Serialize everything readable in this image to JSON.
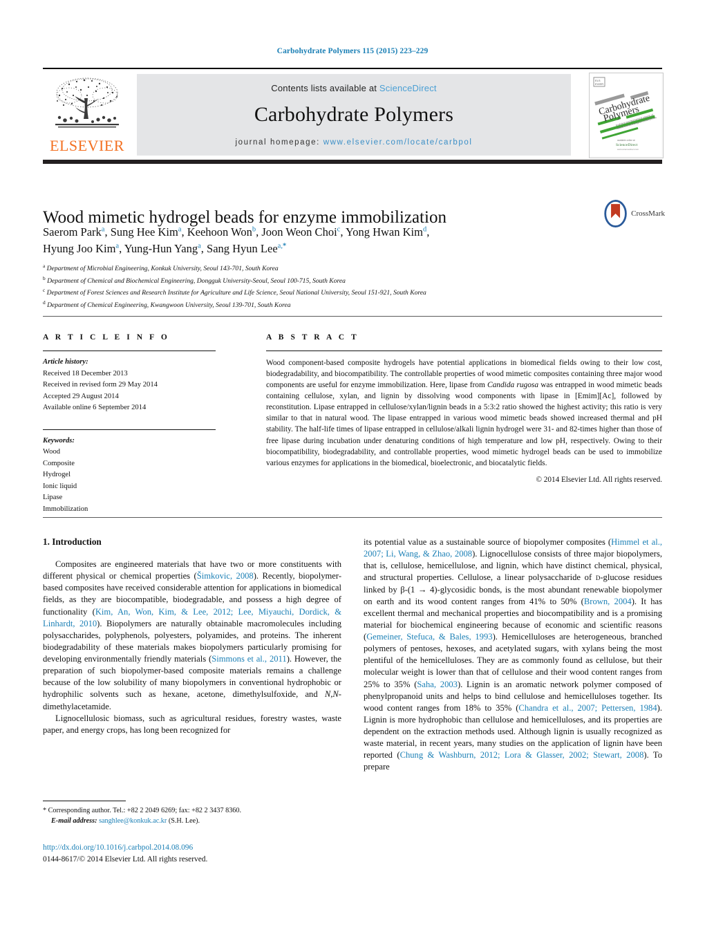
{
  "running_head": "Carbohydrate Polymers 115 (2015) 223–229",
  "masthead": {
    "contents_prefix": "Contents lists available at ",
    "sciencedirect": "ScienceDirect",
    "journal_title": "Carbohydrate Polymers",
    "homepage_prefix": "journal homepage: ",
    "homepage_url": "www.elsevier.com/locate/carbpol",
    "publisher": "ELSEVIER",
    "cover_title_line1": "Carbohydrate",
    "cover_title_line2": "Polymers",
    "accent_blue": "#1a7fb5",
    "elsevier_orange": "#f37021",
    "band_gray": "#e4e5e7"
  },
  "article": {
    "title": "Wood mimetic hydrogel beads for enzyme immobilization",
    "authors_line1": "Saerom Park<sup>a</sup>, Sung Hee Kim<sup>a</sup>, Keehoon Won<sup>b</sup>, Joon Weon Choi<sup>c</sup>, Yong Hwan Kim<sup>d</sup>,",
    "authors_line2": "Hyung Joo Kim<sup>a</sup>, Yung-Hun Yang<sup>a</sup>, Sang Hyun Lee<sup>a,<b>*</b></sup>",
    "crossmark_label": "CrossMark",
    "affiliations": [
      "<sup>a</sup> Department of Microbial Engineering, Konkuk University, Seoul 143-701, South Korea",
      "<sup>b</sup> Department of Chemical and Biochemical Engineering, Dongguk University-Seoul, Seoul 100-715, South Korea",
      "<sup>c</sup> Department of Forest Sciences and Research Institute for Agriculture and Life Science, Seoul National University, Seoul 151-921, South Korea",
      "<sup>d</sup> Department of Chemical Engineering, Kwangwoon University, Seoul 139-701, South Korea"
    ]
  },
  "article_info": {
    "heading": "A R T I C L E    I N F O",
    "history_label": "Article history:",
    "history": [
      "Received 18 December 2013",
      "Received in revised form 29 May 2014",
      "Accepted 29 August 2014",
      "Available online 6 September 2014"
    ],
    "keywords_label": "Keywords:",
    "keywords": [
      "Wood",
      "Composite",
      "Hydrogel",
      "Ionic liquid",
      "Lipase",
      "Immobilization"
    ]
  },
  "abstract": {
    "heading": "A B S T R A C T",
    "text": "Wood component-based composite hydrogels have potential applications in biomedical fields owing to their low cost, biodegradability, and biocompatibility. The controllable properties of wood mimetic composites containing three major wood components are useful for enzyme immobilization. Here, lipase from <i>Candida rugosa</i> was entrapped in wood mimetic beads containing cellulose, xylan, and lignin by dissolving wood components with lipase in [Emim][Ac], followed by reconstitution. Lipase entrapped in cellulose/xylan/lignin beads in a 5:3:2 ratio showed the highest activity; this ratio is very similar to that in natural wood. The lipase entrapped in various wood mimetic beads showed increased thermal and pH stability. The half-life times of lipase entrapped in cellulose/alkali lignin hydrogel were 31- and 82-times higher than those of free lipase during incubation under denaturing conditions of high temperature and low pH, respectively. Owing to their biocompatibility, biodegradability, and controllable properties, wood mimetic hydrogel beads can be used to immobilize various enzymes for applications in the biomedical, bioelectronic, and biocatalytic fields.",
    "copyright": "© 2014 Elsevier Ltd. All rights reserved."
  },
  "body": {
    "section_heading": "1.  Introduction",
    "left_paragraphs": [
      "Composites are engineered materials that have two or more constituents with different physical or chemical properties (<span class=\"cite\">Šimkovic, 2008</span>). Recently, biopolymer-based composites have received considerable attention for applications in biomedical fields, as they are biocompatible, biodegradable, and possess a high degree of functionality (<span class=\"cite\">Kim, An, Won, Kim, &amp; Lee, 2012; Lee, Miyauchi, Dordick, &amp; Linhardt, 2010</span>). Biopolymers are naturally obtainable macromolecules including polysaccharides, polyphenols, polyesters, polyamides, and proteins. The inherent biodegradability of these materials makes biopolymers particularly promising for developing environmentally friendly materials (<span class=\"cite\">Simmons et al., 2011</span>). However, the preparation of such biopolymer-based composite materials remains a challenge because of the low solubility of many biopolymers in conventional hydrophobic or hydrophilic solvents such as hexane, acetone, dimethylsulfoxide, and <i>N,N</i>-dimethylacetamide.",
      "Lignocellulosic biomass, such as agricultural residues, forestry wastes, waste paper, and energy crops, has long been recognized for"
    ],
    "right_paragraphs": [
      "its potential value as a sustainable source of biopolymer composites (<span class=\"cite\">Himmel et al., 2007; Li, Wang, &amp; Zhao, 2008</span>). Lignocellulose consists of three major biopolymers, that is, cellulose, hemicellulose, and lignin, which have distinct chemical, physical, and structural properties. Cellulose, a linear polysaccharide of <span style=\"font-variant:small-caps\">d</span>-glucose residues linked by β-(1 → 4)-glycosidic bonds, is the most abundant renewable biopolymer on earth and its wood content ranges from 41% to 50% (<span class=\"cite\">Brown, 2004</span>). It has excellent thermal and mechanical properties and biocompatibility and is a promising material for biochemical engineering because of economic and scientific reasons (<span class=\"cite\">Gemeiner, Stefuca, &amp; Bales, 1993</span>). Hemicelluloses are heterogeneous, branched polymers of pentoses, hexoses, and acetylated sugars, with xylans being the most plentiful of the hemicelluloses. They are as commonly found as cellulose, but their molecular weight is lower than that of cellulose and their wood content ranges from 25% to 35% (<span class=\"cite\">Saha, 2003</span>). Lignin is an aromatic network polymer composed of phenylpropanoid units and helps to bind cellulose and hemicelluloses together. Its wood content ranges from 18% to 35% (<span class=\"cite\">Chandra et al., 2007; Pettersen, 1984</span>). Lignin is more hydrophobic than cellulose and hemicelluloses, and its properties are dependent on the extraction methods used. Although lignin is usually recognized as waste material, in recent years, many studies on the application of lignin have been reported (<span class=\"cite\">Chung &amp; Washburn, 2012; Lora &amp; Glasser, 2002; Stewart, 2008</span>). To prepare"
    ]
  },
  "footer": {
    "corresponding": "* Corresponding author. Tel.: +82 2 2049 6269; fax: +82 2 3437 8360.",
    "email_label": "E-mail address:",
    "email": "sanghlee@konkuk.ac.kr",
    "email_suffix": "(S.H. Lee).",
    "doi": "http://dx.doi.org/10.1016/j.carbpol.2014.08.096",
    "issn_line": "0144-8617/© 2014 Elsevier Ltd. All rights reserved."
  }
}
